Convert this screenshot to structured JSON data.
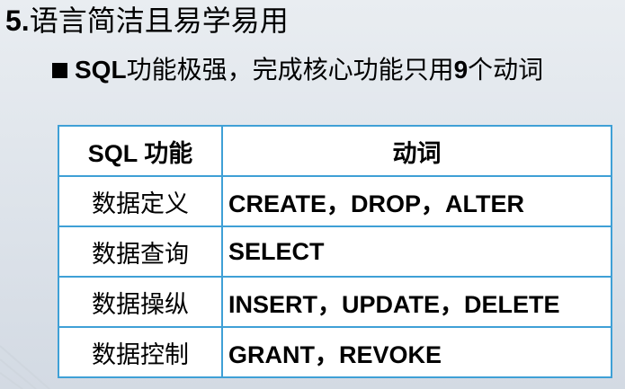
{
  "heading": {
    "number": "5.",
    "text": "语言简洁且易学易用"
  },
  "bullet": {
    "prefix": "SQL",
    "text": "功能极强，完成核心功能只用",
    "count": "9",
    "suffix": "个动词"
  },
  "table": {
    "headers": [
      "SQL 功能",
      "动词"
    ],
    "rows": [
      {
        "function": "数据定义",
        "verbs": "CREATE，DROP，ALTER"
      },
      {
        "function": "数据查询",
        "verbs": "SELECT"
      },
      {
        "function": "数据操纵",
        "verbs": "INSERT，UPDATE，DELETE"
      },
      {
        "function": "数据控制",
        "verbs": "GRANT，REVOKE"
      }
    ]
  },
  "colors": {
    "table_border": "#3fa0d6",
    "background": "#e3e8ed"
  }
}
